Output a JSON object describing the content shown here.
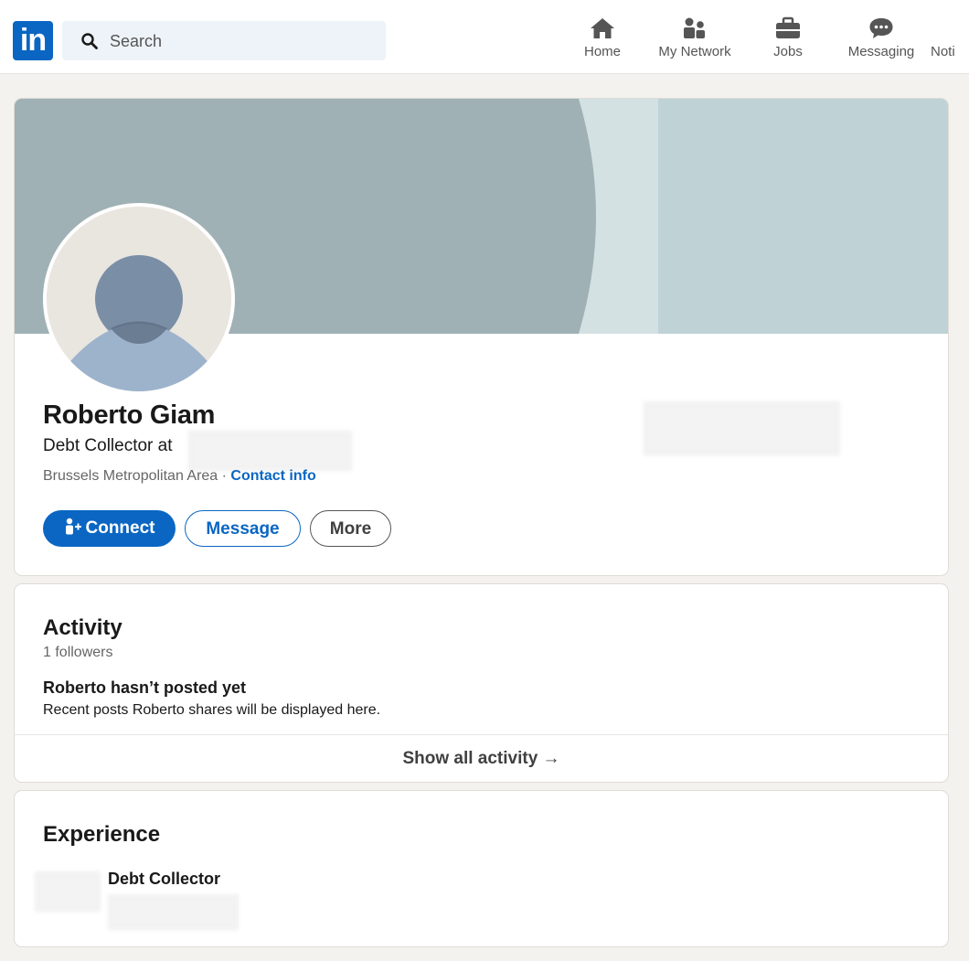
{
  "nav": {
    "search_placeholder": "Search",
    "items": [
      {
        "label": "Home",
        "icon": "home-icon"
      },
      {
        "label": "My Network",
        "icon": "network-icon"
      },
      {
        "label": "Jobs",
        "icon": "briefcase-icon"
      },
      {
        "label": "Messaging",
        "icon": "message-icon"
      },
      {
        "label": "Noti",
        "icon": "bell-icon"
      }
    ]
  },
  "profile": {
    "name": "Roberto Giam",
    "headline": "Debt Collector at",
    "location": "Brussels Metropolitan Area · ",
    "contact_info": "Contact info",
    "buttons": {
      "connect": "Connect",
      "message": "Message",
      "more": "More"
    }
  },
  "activity": {
    "title": "Activity",
    "followers": "1 followers",
    "empty_title": "Roberto hasn’t posted yet",
    "empty_body": "Recent posts Roberto shares will be displayed here.",
    "show_all": "Show all activity →"
  },
  "experience": {
    "title": "Experience",
    "items": [
      {
        "role": "Debt Collector"
      }
    ]
  },
  "colors": {
    "brand": "#0a66c2",
    "page_bg": "#f4f2ee",
    "banner_light": "#bfd3d6",
    "banner_dark": "#9fb1b4"
  }
}
